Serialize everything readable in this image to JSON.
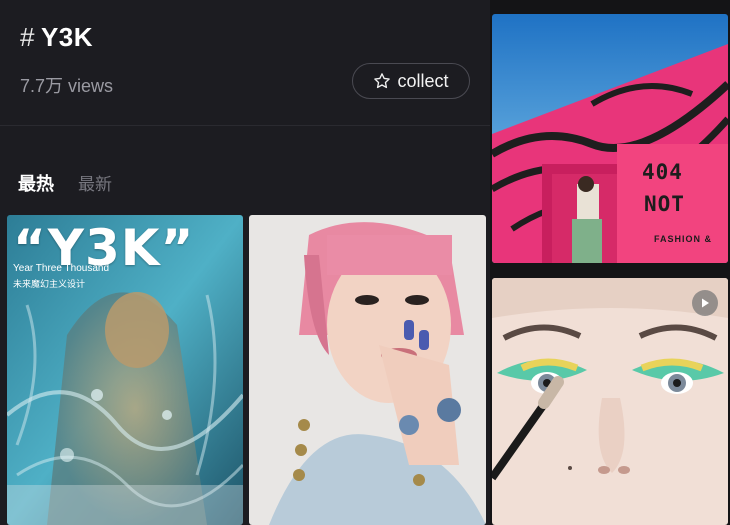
{
  "header": {
    "hash_symbol": "#",
    "topic_title": "Y3K",
    "views": "7.7万 views",
    "collect_label": "collect",
    "collect_icon": "star-outline-icon"
  },
  "tabs": [
    {
      "label": "最热",
      "active": true
    },
    {
      "label": "最新",
      "active": false
    }
  ],
  "posts": [
    {
      "id": "post-1",
      "overlay_title": "“Y3K”",
      "overlay_subtitle": "Year Three Thousand",
      "overlay_caption": "未来魔幻主义设计"
    },
    {
      "id": "post-2"
    },
    {
      "id": "post-3",
      "sign_line1": "404",
      "sign_line2": "NOT",
      "sign_line3": "FASHION  &"
    },
    {
      "id": "post-4",
      "media_icon": "play-icon"
    }
  ],
  "colors": {
    "background": "#121214",
    "panel": "#1c1c21",
    "text_secondary": "#9a9aa2",
    "tab_inactive": "#77777f"
  }
}
